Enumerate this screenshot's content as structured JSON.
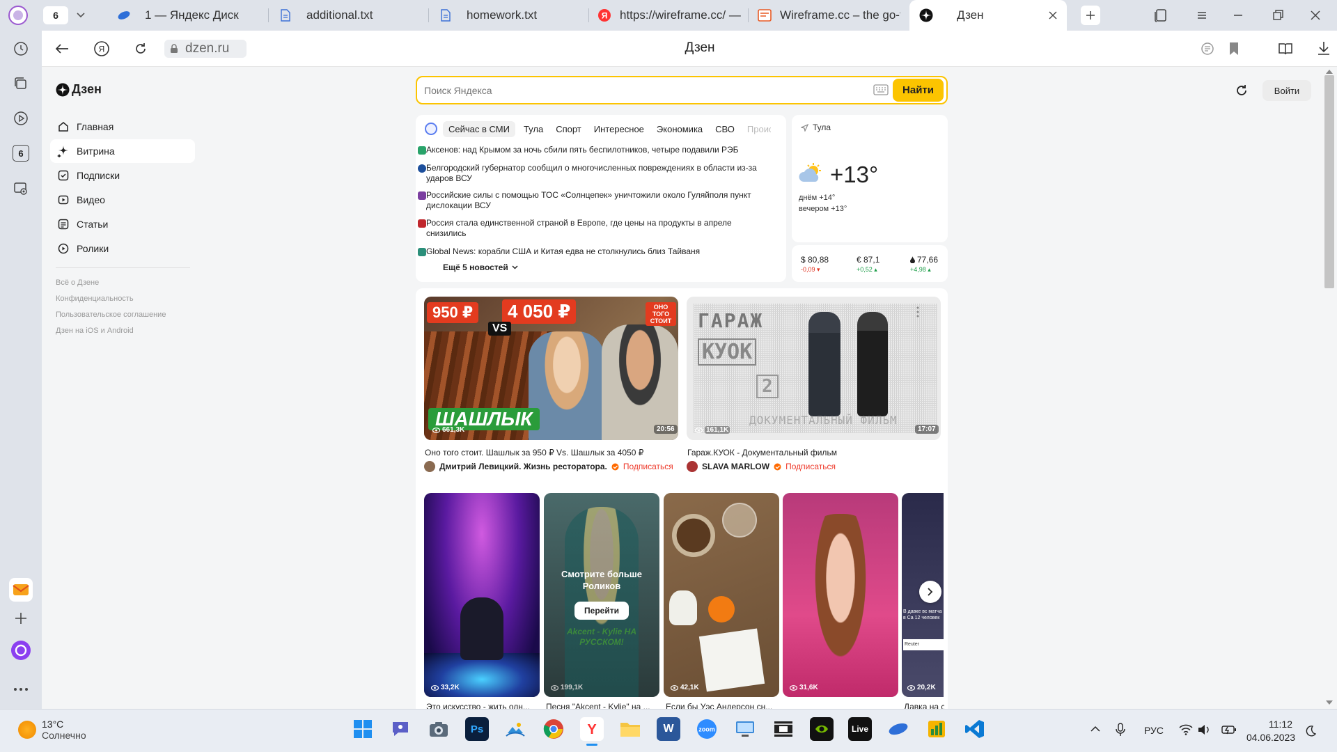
{
  "tabs": {
    "count": "6",
    "items": [
      {
        "label": "1 — Яндекс Диск"
      },
      {
        "label": "additional.txt"
      },
      {
        "label": "homework.txt"
      },
      {
        "label": "https://wireframe.cc/ —"
      },
      {
        "label": "Wireframe.cc – the go-to"
      },
      {
        "label": "Дзен"
      }
    ]
  },
  "rail": {
    "badge": "6"
  },
  "address": {
    "url": "dzen.ru",
    "title": "Дзен"
  },
  "dzen": {
    "logo": "Дзен",
    "search_placeholder": "Поиск Яндекса",
    "search_button": "Найти",
    "login": "Войти",
    "nav": [
      {
        "label": "Главная",
        "icon": "home-icon"
      },
      {
        "label": "Витрина",
        "icon": "sparkle-icon"
      },
      {
        "label": "Подписки",
        "icon": "subscriptions-icon"
      },
      {
        "label": "Видео",
        "icon": "video-icon"
      },
      {
        "label": "Статьи",
        "icon": "article-icon"
      },
      {
        "label": "Ролики",
        "icon": "shorts-icon"
      }
    ],
    "footer": [
      "Всё о Дзене",
      "Конфиденциальность",
      "Пользовательское соглашение",
      "Дзен на iOS и Android"
    ]
  },
  "news": {
    "tabs": [
      "Сейчас в СМИ",
      "Тула",
      "Спорт",
      "Интересное",
      "Экономика",
      "СВО",
      "Проис"
    ],
    "items": [
      {
        "text": "Аксенов: над Крымом за ночь сбили пять беспилотников, четыре подавили РЭБ",
        "color": "#29a36a"
      },
      {
        "text": "Белгородский губернатор сообщил о многочисленных повреждениях в области из-за ударов ВСУ",
        "color": "#1d4f9c"
      },
      {
        "text": "Российские силы с помощью ТОС «Солнцепек» уничтожили около Гуляйполя пункт дислокации ВСУ",
        "color": "#7b3fa0"
      },
      {
        "text": "Россия стала единственной страной в Европе, где цены на продукты в апреле снизились",
        "color": "#c0272d"
      },
      {
        "text": "Global News: корабли США и Китая едва не столкнулись близ Тайваня",
        "color": "#2b8f7a"
      }
    ],
    "more": "Ещё 5 новостей"
  },
  "weather": {
    "city": "Тула",
    "temp": "+13°",
    "day": "днём +14°",
    "evening": "вечером +13°"
  },
  "rates": [
    {
      "label": "$ 80,88",
      "delta": "-0,09 ▾",
      "color": "#e0301e"
    },
    {
      "label": "€ 87,1",
      "delta": "+0,52 ▴",
      "color": "#1e9e4a"
    },
    {
      "label": "77,66",
      "delta": "+4,98 ▴",
      "color": "#1e9e4a"
    }
  ],
  "videos": [
    {
      "views": "661,3K",
      "duration": "20:56",
      "title": "Оно того стоит. Шашлык за 950 ₽ Vs. Шашлык за 4050 ₽",
      "channel": "Дмитрий Левицкий. Жизнь ресторатора.",
      "subscribe": "Подписаться",
      "thumb_text": {
        "price1": "950 ₽",
        "price2": "4 050 ₽",
        "vs": "VS",
        "word": "ШАШЛЫК",
        "badge": "ОНО ТОГО СТОИТ"
      }
    },
    {
      "views": "161,1K",
      "duration": "17:07",
      "title": "Гараж.КУОК - Документальный фильм",
      "channel": "SLAVA MARLOW",
      "subscribe": "Подписаться",
      "thumb_text": {
        "brand": "ГАРАЖ",
        "name": "КУОК",
        "num": "2",
        "caption": "ДОКУМЕНТАЛЬНЫЙ ФИЛЬМ"
      }
    }
  ],
  "shorts": {
    "overlay_title": "Смотрите больше Роликов",
    "overlay_button": "Перейти",
    "overlay_caption": "Akcent - Kylie НА РУССКОМ!",
    "partial_caption": "В давке вс матча в Са 12 человек",
    "partial_source": "Reuter",
    "items": [
      {
        "views": "33,2K",
        "title": "Это искусство - жить олн..."
      },
      {
        "views": "199,1K",
        "title": "Песня \"Akcent - Kylie\" на ..."
      },
      {
        "views": "42,1K",
        "title": "Если бы Уэс Андерсон сн..."
      },
      {
        "views": "31,6K",
        "title": ""
      },
      {
        "views": "20,2K",
        "title": "Давка на с"
      }
    ]
  },
  "taskbar": {
    "weather_temp": "13°C",
    "weather_desc": "Солнечно",
    "lang": "РУС",
    "time": "11:12",
    "date": "04.06.2023"
  }
}
